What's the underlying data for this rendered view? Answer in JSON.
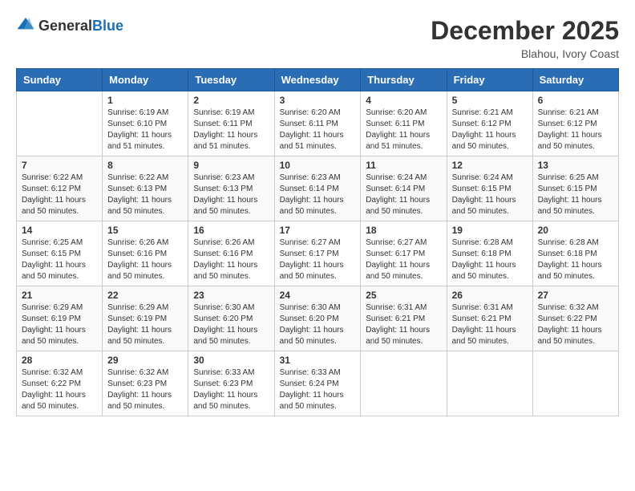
{
  "logo": {
    "general": "General",
    "blue": "Blue"
  },
  "title": {
    "month_year": "December 2025",
    "location": "Blahou, Ivory Coast"
  },
  "days_of_week": [
    "Sunday",
    "Monday",
    "Tuesday",
    "Wednesday",
    "Thursday",
    "Friday",
    "Saturday"
  ],
  "weeks": [
    [
      {
        "day": "",
        "sunrise": "",
        "sunset": "",
        "daylight": ""
      },
      {
        "day": "1",
        "sunrise": "Sunrise: 6:19 AM",
        "sunset": "Sunset: 6:10 PM",
        "daylight": "Daylight: 11 hours and 51 minutes."
      },
      {
        "day": "2",
        "sunrise": "Sunrise: 6:19 AM",
        "sunset": "Sunset: 6:11 PM",
        "daylight": "Daylight: 11 hours and 51 minutes."
      },
      {
        "day": "3",
        "sunrise": "Sunrise: 6:20 AM",
        "sunset": "Sunset: 6:11 PM",
        "daylight": "Daylight: 11 hours and 51 minutes."
      },
      {
        "day": "4",
        "sunrise": "Sunrise: 6:20 AM",
        "sunset": "Sunset: 6:11 PM",
        "daylight": "Daylight: 11 hours and 51 minutes."
      },
      {
        "day": "5",
        "sunrise": "Sunrise: 6:21 AM",
        "sunset": "Sunset: 6:12 PM",
        "daylight": "Daylight: 11 hours and 50 minutes."
      },
      {
        "day": "6",
        "sunrise": "Sunrise: 6:21 AM",
        "sunset": "Sunset: 6:12 PM",
        "daylight": "Daylight: 11 hours and 50 minutes."
      }
    ],
    [
      {
        "day": "7",
        "sunrise": "Sunrise: 6:22 AM",
        "sunset": "Sunset: 6:12 PM",
        "daylight": "Daylight: 11 hours and 50 minutes."
      },
      {
        "day": "8",
        "sunrise": "Sunrise: 6:22 AM",
        "sunset": "Sunset: 6:13 PM",
        "daylight": "Daylight: 11 hours and 50 minutes."
      },
      {
        "day": "9",
        "sunrise": "Sunrise: 6:23 AM",
        "sunset": "Sunset: 6:13 PM",
        "daylight": "Daylight: 11 hours and 50 minutes."
      },
      {
        "day": "10",
        "sunrise": "Sunrise: 6:23 AM",
        "sunset": "Sunset: 6:14 PM",
        "daylight": "Daylight: 11 hours and 50 minutes."
      },
      {
        "day": "11",
        "sunrise": "Sunrise: 6:24 AM",
        "sunset": "Sunset: 6:14 PM",
        "daylight": "Daylight: 11 hours and 50 minutes."
      },
      {
        "day": "12",
        "sunrise": "Sunrise: 6:24 AM",
        "sunset": "Sunset: 6:15 PM",
        "daylight": "Daylight: 11 hours and 50 minutes."
      },
      {
        "day": "13",
        "sunrise": "Sunrise: 6:25 AM",
        "sunset": "Sunset: 6:15 PM",
        "daylight": "Daylight: 11 hours and 50 minutes."
      }
    ],
    [
      {
        "day": "14",
        "sunrise": "Sunrise: 6:25 AM",
        "sunset": "Sunset: 6:15 PM",
        "daylight": "Daylight: 11 hours and 50 minutes."
      },
      {
        "day": "15",
        "sunrise": "Sunrise: 6:26 AM",
        "sunset": "Sunset: 6:16 PM",
        "daylight": "Daylight: 11 hours and 50 minutes."
      },
      {
        "day": "16",
        "sunrise": "Sunrise: 6:26 AM",
        "sunset": "Sunset: 6:16 PM",
        "daylight": "Daylight: 11 hours and 50 minutes."
      },
      {
        "day": "17",
        "sunrise": "Sunrise: 6:27 AM",
        "sunset": "Sunset: 6:17 PM",
        "daylight": "Daylight: 11 hours and 50 minutes."
      },
      {
        "day": "18",
        "sunrise": "Sunrise: 6:27 AM",
        "sunset": "Sunset: 6:17 PM",
        "daylight": "Daylight: 11 hours and 50 minutes."
      },
      {
        "day": "19",
        "sunrise": "Sunrise: 6:28 AM",
        "sunset": "Sunset: 6:18 PM",
        "daylight": "Daylight: 11 hours and 50 minutes."
      },
      {
        "day": "20",
        "sunrise": "Sunrise: 6:28 AM",
        "sunset": "Sunset: 6:18 PM",
        "daylight": "Daylight: 11 hours and 50 minutes."
      }
    ],
    [
      {
        "day": "21",
        "sunrise": "Sunrise: 6:29 AM",
        "sunset": "Sunset: 6:19 PM",
        "daylight": "Daylight: 11 hours and 50 minutes."
      },
      {
        "day": "22",
        "sunrise": "Sunrise: 6:29 AM",
        "sunset": "Sunset: 6:19 PM",
        "daylight": "Daylight: 11 hours and 50 minutes."
      },
      {
        "day": "23",
        "sunrise": "Sunrise: 6:30 AM",
        "sunset": "Sunset: 6:20 PM",
        "daylight": "Daylight: 11 hours and 50 minutes."
      },
      {
        "day": "24",
        "sunrise": "Sunrise: 6:30 AM",
        "sunset": "Sunset: 6:20 PM",
        "daylight": "Daylight: 11 hours and 50 minutes."
      },
      {
        "day": "25",
        "sunrise": "Sunrise: 6:31 AM",
        "sunset": "Sunset: 6:21 PM",
        "daylight": "Daylight: 11 hours and 50 minutes."
      },
      {
        "day": "26",
        "sunrise": "Sunrise: 6:31 AM",
        "sunset": "Sunset: 6:21 PM",
        "daylight": "Daylight: 11 hours and 50 minutes."
      },
      {
        "day": "27",
        "sunrise": "Sunrise: 6:32 AM",
        "sunset": "Sunset: 6:22 PM",
        "daylight": "Daylight: 11 hours and 50 minutes."
      }
    ],
    [
      {
        "day": "28",
        "sunrise": "Sunrise: 6:32 AM",
        "sunset": "Sunset: 6:22 PM",
        "daylight": "Daylight: 11 hours and 50 minutes."
      },
      {
        "day": "29",
        "sunrise": "Sunrise: 6:32 AM",
        "sunset": "Sunset: 6:23 PM",
        "daylight": "Daylight: 11 hours and 50 minutes."
      },
      {
        "day": "30",
        "sunrise": "Sunrise: 6:33 AM",
        "sunset": "Sunset: 6:23 PM",
        "daylight": "Daylight: 11 hours and 50 minutes."
      },
      {
        "day": "31",
        "sunrise": "Sunrise: 6:33 AM",
        "sunset": "Sunset: 6:24 PM",
        "daylight": "Daylight: 11 hours and 50 minutes."
      },
      {
        "day": "",
        "sunrise": "",
        "sunset": "",
        "daylight": ""
      },
      {
        "day": "",
        "sunrise": "",
        "sunset": "",
        "daylight": ""
      },
      {
        "day": "",
        "sunrise": "",
        "sunset": "",
        "daylight": ""
      }
    ]
  ]
}
